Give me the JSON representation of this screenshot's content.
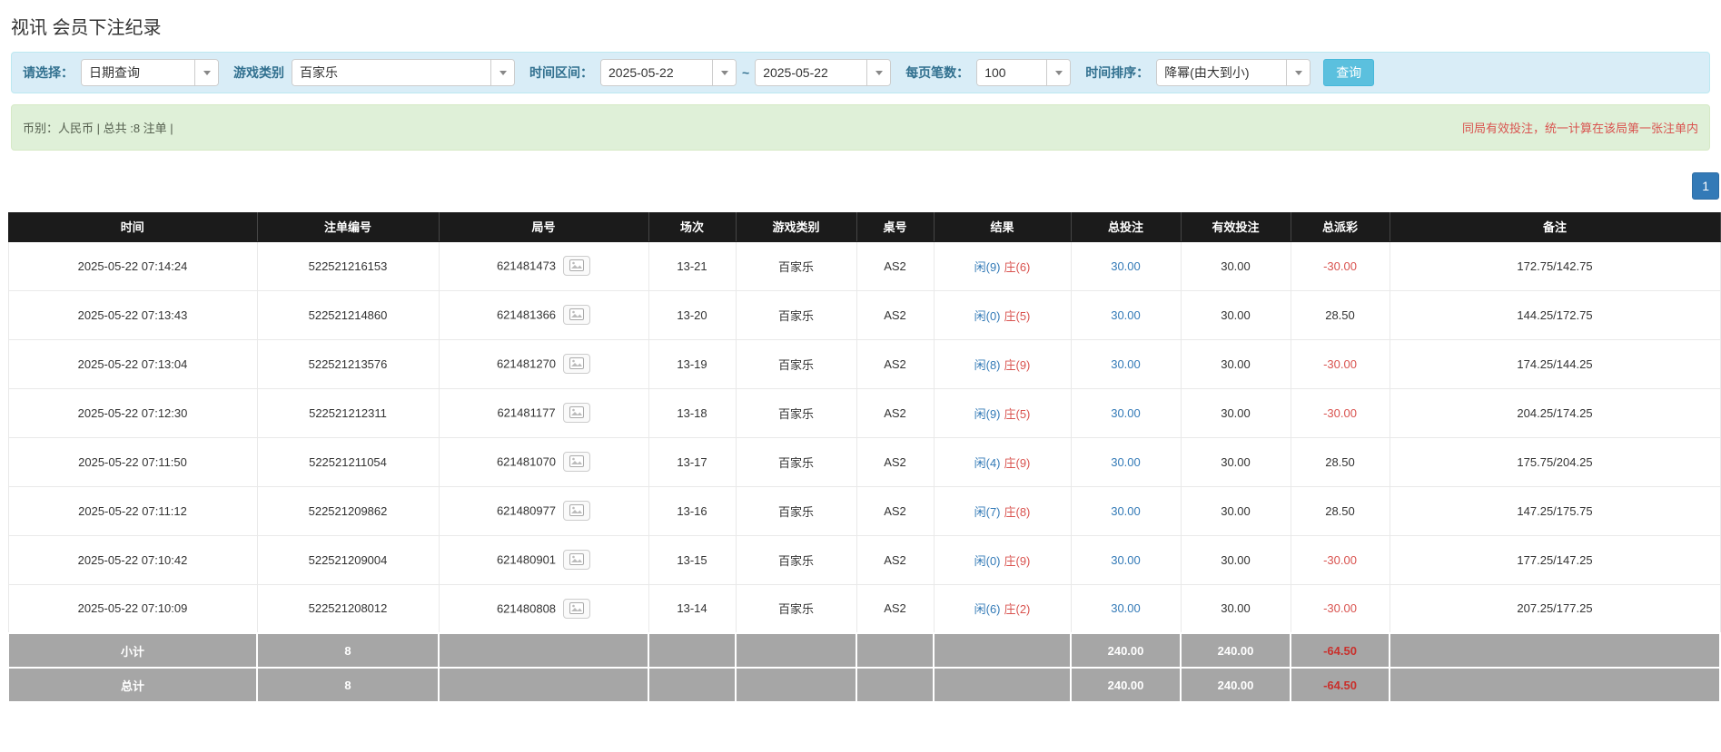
{
  "page": {
    "title": "视讯 会员下注纪录"
  },
  "filters": {
    "select_label": "请选择：",
    "select_value": "日期查询",
    "game_type_label": "游戏类别",
    "game_type_value": "百家乐",
    "date_range_label": "时间区间：",
    "date_from": "2025-05-22",
    "date_to": "2025-05-22",
    "range_separator": "~",
    "page_size_label": "每页笔数：",
    "page_size_value": "100",
    "sort_label": "时间排序：",
    "sort_value": "降幂(由大到小)",
    "search_button": "查询"
  },
  "summary": {
    "left": "币别：人民币 | 总共 :8 注单 |",
    "right": "同局有效投注，统一计算在该局第一张注单内"
  },
  "pagination": {
    "current": "1"
  },
  "colors": {
    "accent_blue": "#337ab7",
    "danger_red": "#d9534f",
    "header_black": "#1b1b1b",
    "filter_bg": "#d9edf7",
    "summary_bg": "#dff0d8",
    "footer_gray": "#a6a6a6"
  },
  "table": {
    "headers": [
      "时间",
      "注单编号",
      "局号",
      "场次",
      "游戏类别",
      "桌号",
      "结果",
      "总投注",
      "有效投注",
      "总派彩",
      "备注"
    ],
    "rows": [
      {
        "time": "2025-05-22 07:14:24",
        "bet_id": "522521216153",
        "round_id": "621481473",
        "session": "13-21",
        "game": "百家乐",
        "table_no": "AS2",
        "result_player": "闲(9)",
        "result_banker": "庄(6)",
        "total_bet": "30.00",
        "valid_bet": "30.00",
        "payout": "-30.00",
        "remark": "172.75/142.75"
      },
      {
        "time": "2025-05-22 07:13:43",
        "bet_id": "522521214860",
        "round_id": "621481366",
        "session": "13-20",
        "game": "百家乐",
        "table_no": "AS2",
        "result_player": "闲(0)",
        "result_banker": "庄(5)",
        "total_bet": "30.00",
        "valid_bet": "30.00",
        "payout": "28.50",
        "remark": "144.25/172.75"
      },
      {
        "time": "2025-05-22 07:13:04",
        "bet_id": "522521213576",
        "round_id": "621481270",
        "session": "13-19",
        "game": "百家乐",
        "table_no": "AS2",
        "result_player": "闲(8)",
        "result_banker": "庄(9)",
        "total_bet": "30.00",
        "valid_bet": "30.00",
        "payout": "-30.00",
        "remark": "174.25/144.25"
      },
      {
        "time": "2025-05-22 07:12:30",
        "bet_id": "522521212311",
        "round_id": "621481177",
        "session": "13-18",
        "game": "百家乐",
        "table_no": "AS2",
        "result_player": "闲(9)",
        "result_banker": "庄(5)",
        "total_bet": "30.00",
        "valid_bet": "30.00",
        "payout": "-30.00",
        "remark": "204.25/174.25"
      },
      {
        "time": "2025-05-22 07:11:50",
        "bet_id": "522521211054",
        "round_id": "621481070",
        "session": "13-17",
        "game": "百家乐",
        "table_no": "AS2",
        "result_player": "闲(4)",
        "result_banker": "庄(9)",
        "total_bet": "30.00",
        "valid_bet": "30.00",
        "payout": "28.50",
        "remark": "175.75/204.25"
      },
      {
        "time": "2025-05-22 07:11:12",
        "bet_id": "522521209862",
        "round_id": "621480977",
        "session": "13-16",
        "game": "百家乐",
        "table_no": "AS2",
        "result_player": "闲(7)",
        "result_banker": "庄(8)",
        "total_bet": "30.00",
        "valid_bet": "30.00",
        "payout": "28.50",
        "remark": "147.25/175.75"
      },
      {
        "time": "2025-05-22 07:10:42",
        "bet_id": "522521209004",
        "round_id": "621480901",
        "session": "13-15",
        "game": "百家乐",
        "table_no": "AS2",
        "result_player": "闲(0)",
        "result_banker": "庄(9)",
        "total_bet": "30.00",
        "valid_bet": "30.00",
        "payout": "-30.00",
        "remark": "177.25/147.25"
      },
      {
        "time": "2025-05-22 07:10:09",
        "bet_id": "522521208012",
        "round_id": "621480808",
        "session": "13-14",
        "game": "百家乐",
        "table_no": "AS2",
        "result_player": "闲(6)",
        "result_banker": "庄(2)",
        "total_bet": "30.00",
        "valid_bet": "30.00",
        "payout": "-30.00",
        "remark": "207.25/177.25"
      }
    ],
    "subtotal": {
      "label": "小计",
      "count": "8",
      "total_bet": "240.00",
      "valid_bet": "240.00",
      "payout": "-64.50"
    },
    "total": {
      "label": "总计",
      "count": "8",
      "total_bet": "240.00",
      "valid_bet": "240.00",
      "payout": "-64.50"
    }
  }
}
